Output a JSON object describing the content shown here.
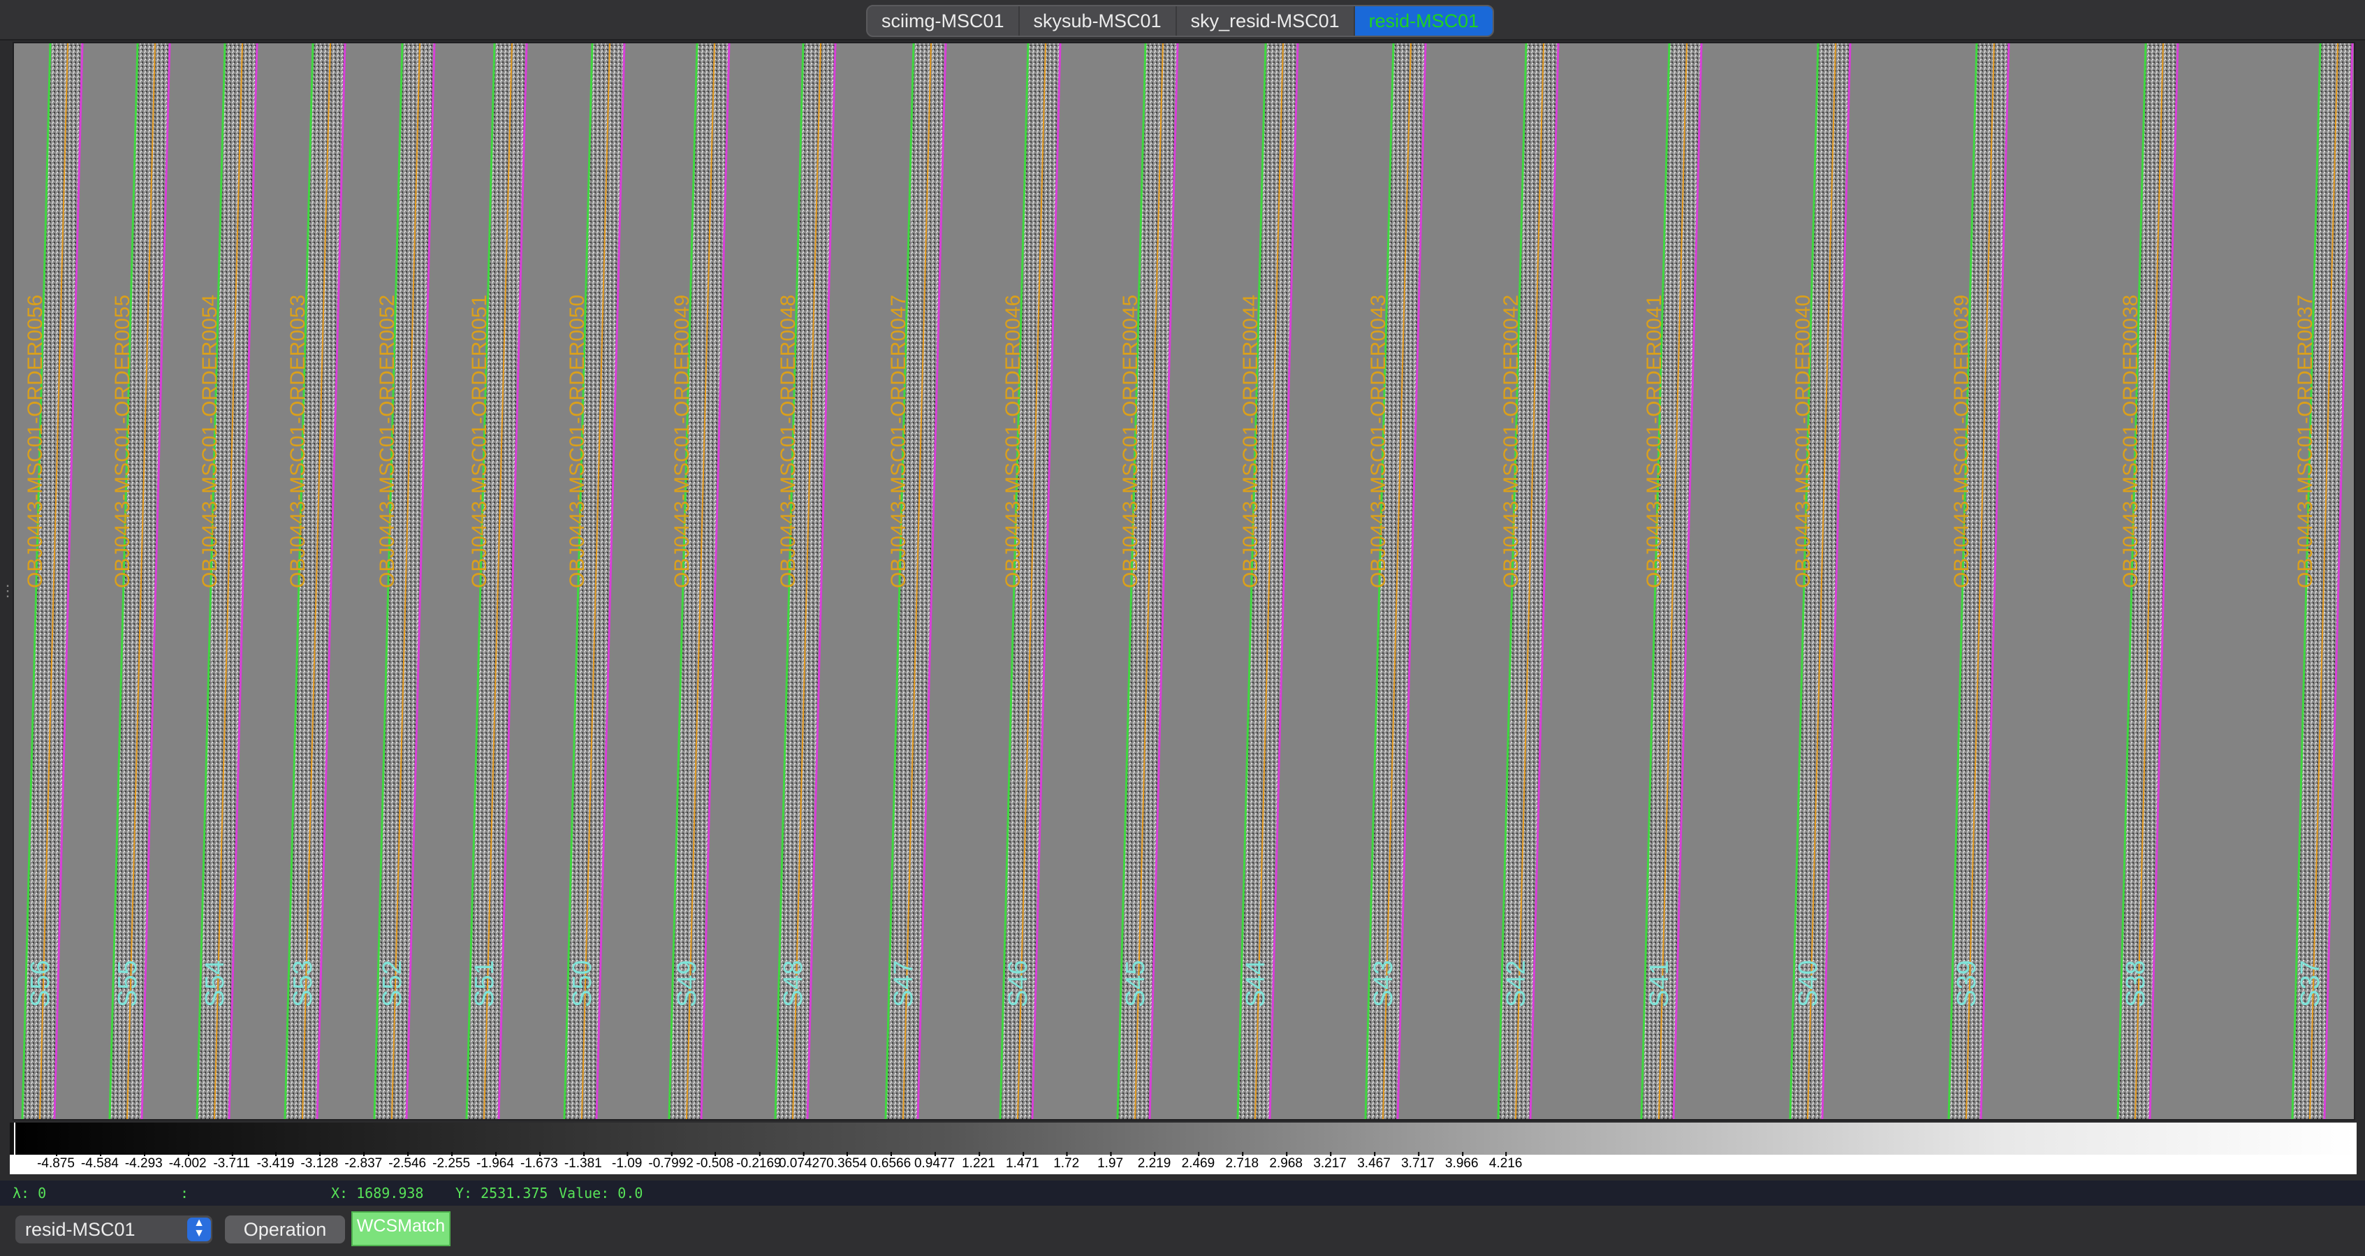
{
  "tabs": [
    "sciimg-MSC01",
    "skysub-MSC01",
    "sky_resid-MSC01",
    "resid-MSC01"
  ],
  "active_tab": "resid-MSC01",
  "viewer": {
    "slits": [
      {
        "slit": "S56",
        "order": "OBJ0443-MSC01-ORDER0056"
      },
      {
        "slit": "S55",
        "order": "OBJ0443-MSC01-ORDER0055"
      },
      {
        "slit": "S54",
        "order": "OBJ0443-MSC01-ORDER0054"
      },
      {
        "slit": "S53",
        "order": "OBJ0443-MSC01-ORDER0053"
      },
      {
        "slit": "S52",
        "order": "OBJ0443-MSC01-ORDER0052"
      },
      {
        "slit": "S51",
        "order": "OBJ0443-MSC01-ORDER0051"
      },
      {
        "slit": "S50",
        "order": "OBJ0443-MSC01-ORDER0050"
      },
      {
        "slit": "S49",
        "order": "OBJ0443-MSC01-ORDER0049"
      },
      {
        "slit": "S48",
        "order": "OBJ0443-MSC01-ORDER0048"
      },
      {
        "slit": "S47",
        "order": "OBJ0443-MSC01-ORDER0047"
      },
      {
        "slit": "S46",
        "order": "OBJ0443-MSC01-ORDER0046"
      },
      {
        "slit": "S45",
        "order": "OBJ0443-MSC01-ORDER0045"
      },
      {
        "slit": "S44",
        "order": "OBJ0443-MSC01-ORDER0044"
      },
      {
        "slit": "S43",
        "order": "OBJ0443-MSC01-ORDER0043"
      },
      {
        "slit": "S42",
        "order": "OBJ0443-MSC01-ORDER0042"
      },
      {
        "slit": "S41",
        "order": "OBJ0443-MSC01-ORDER0041"
      },
      {
        "slit": "S40",
        "order": "OBJ0443-MSC01-ORDER0040"
      },
      {
        "slit": "S39",
        "order": "OBJ0443-MSC01-ORDER0039"
      },
      {
        "slit": "S38",
        "order": "OBJ0443-MSC01-ORDER0038"
      },
      {
        "slit": "S37",
        "order": "OBJ0443-MSC01-ORDER0037"
      }
    ],
    "colors": {
      "background": "#838383",
      "left_edge": "#3fd83f",
      "right_edge": "#d93fd9",
      "trace": "#e49a1e",
      "slit_label": "#7fe3d8",
      "order_label": "#dba01a"
    }
  },
  "colorbar": {
    "ticks": [
      "-4.875",
      "-4.584",
      "-4.293",
      "-4.002",
      "-3.711",
      "-3.419",
      "-3.128",
      "-2.837",
      "-2.546",
      "-2.255",
      "-1.964",
      "-1.673",
      "-1.381",
      "-1.09",
      "-0.7992",
      "-0.508",
      "-0.2169",
      "0.07427",
      "0.3654",
      "0.6566",
      "0.9477",
      "1.221",
      "1.471",
      "1.72",
      "1.97",
      "2.219",
      "2.469",
      "2.718",
      "2.968",
      "3.217",
      "3.467",
      "3.717",
      "3.966",
      "4.216"
    ]
  },
  "status": {
    "lambda": "λ: 0",
    "sep": ":",
    "x": "X: 1689.938",
    "y": "Y: 2531.375",
    "value": "Value: 0.0"
  },
  "toolbar": {
    "frame_select": "resid-MSC01",
    "operation_label": "Operation",
    "wcsmatch_label": "WCSMatch"
  }
}
